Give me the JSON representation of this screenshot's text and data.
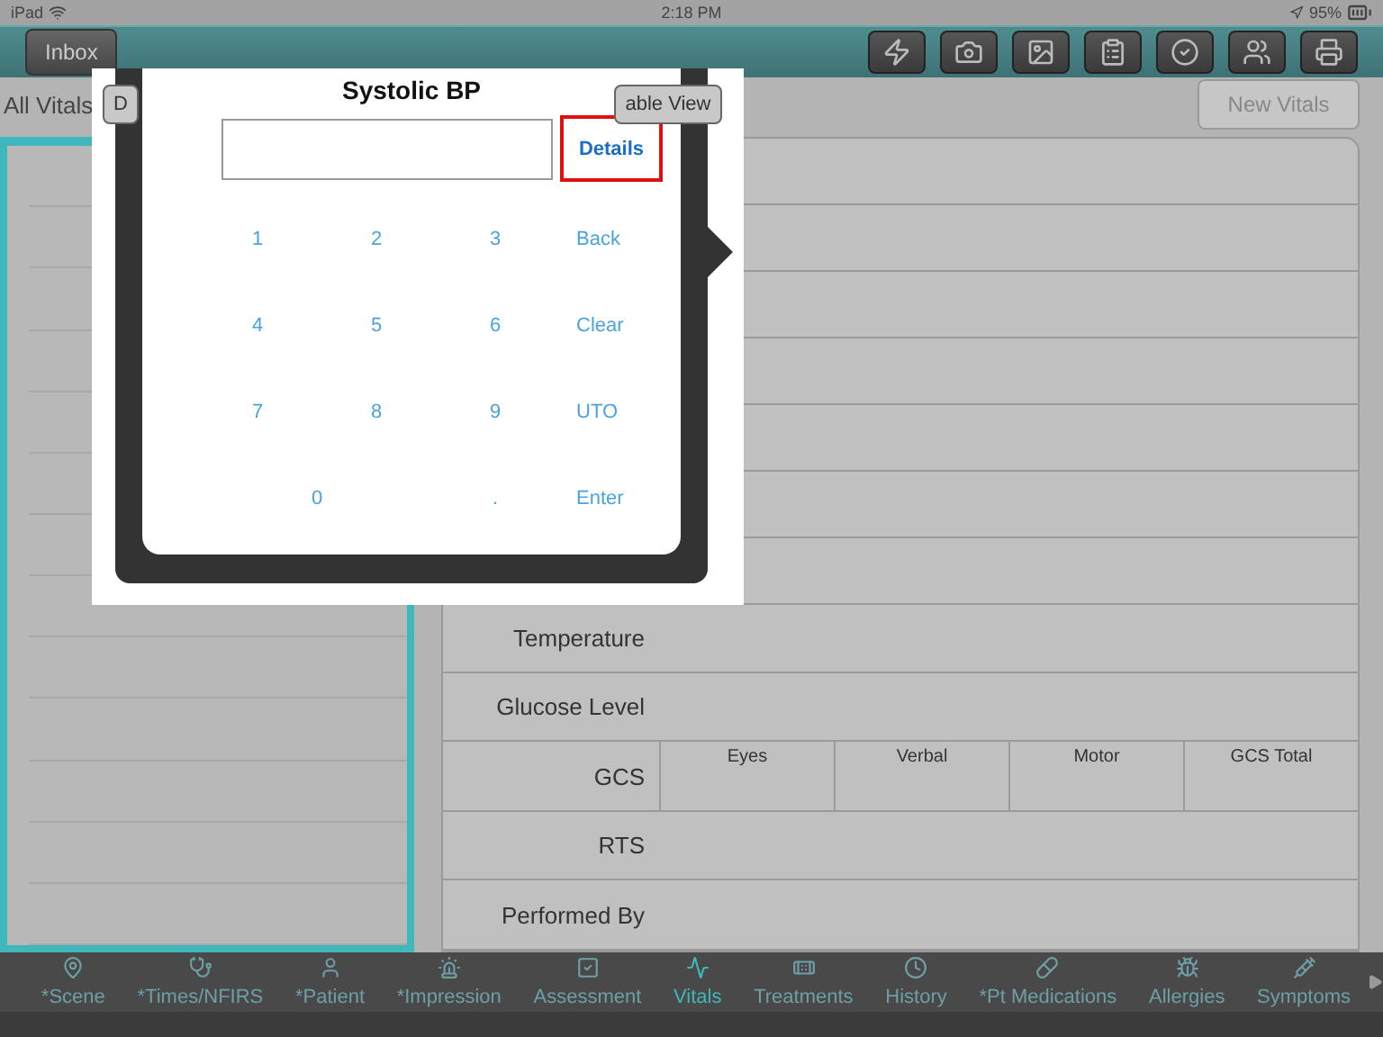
{
  "status_bar": {
    "device": "iPad",
    "time": "2:18 PM",
    "battery": "95%"
  },
  "toolbar": {
    "inbox": "Inbox"
  },
  "header": {
    "title": "All Vitals",
    "segment_left": "D",
    "segment_right": "able View",
    "new_button": "New Vitals"
  },
  "vitals_table": {
    "rows": [
      {
        "kind": "text",
        "label": "Temperature"
      },
      {
        "kind": "text",
        "label": "Glucose Level"
      },
      {
        "kind": "gcs",
        "label": "GCS",
        "columns": [
          "Eyes",
          "Verbal",
          "Motor",
          "GCS Total"
        ]
      },
      {
        "kind": "text",
        "label": "RTS"
      },
      {
        "kind": "text",
        "label": "Performed By"
      }
    ]
  },
  "popover": {
    "title": "Systolic BP",
    "details": "Details",
    "details_highlighted": true,
    "keys": [
      {
        "label": "1",
        "kind": "digit"
      },
      {
        "label": "2",
        "kind": "digit"
      },
      {
        "label": "3",
        "kind": "digit"
      },
      {
        "label": "Back",
        "kind": "action"
      },
      {
        "label": "4",
        "kind": "digit"
      },
      {
        "label": "5",
        "kind": "digit"
      },
      {
        "label": "6",
        "kind": "digit"
      },
      {
        "label": "Clear",
        "kind": "action"
      },
      {
        "label": "7",
        "kind": "digit"
      },
      {
        "label": "8",
        "kind": "digit"
      },
      {
        "label": "9",
        "kind": "digit"
      },
      {
        "label": "UTO",
        "kind": "action"
      },
      {
        "label": "0",
        "kind": "wide"
      },
      {
        "label": ".",
        "kind": "digit"
      },
      {
        "label": "Enter",
        "kind": "action"
      }
    ]
  },
  "tabs": [
    {
      "label": "*Scene",
      "selected": false
    },
    {
      "label": "*Times/NFIRS",
      "selected": false
    },
    {
      "label": "*Patient",
      "selected": false
    },
    {
      "label": "*Impression",
      "selected": false
    },
    {
      "label": "Assessment",
      "selected": false
    },
    {
      "label": "Vitals",
      "selected": true
    },
    {
      "label": "Treatments",
      "selected": false
    },
    {
      "label": "History",
      "selected": false
    },
    {
      "label": "*Pt Medications",
      "selected": false
    },
    {
      "label": "Allergies",
      "selected": false
    },
    {
      "label": "Symptoms",
      "selected": false
    }
  ]
}
